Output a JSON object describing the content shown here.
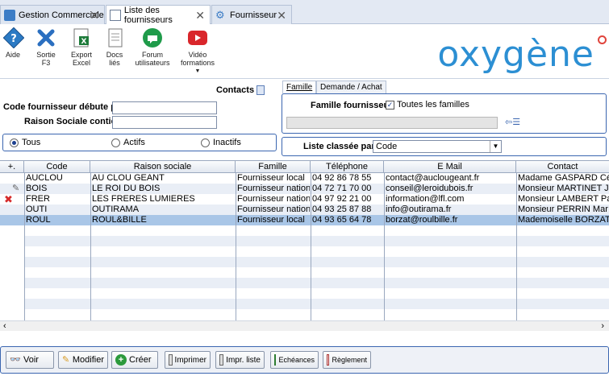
{
  "tabs": [
    {
      "label": "Gestion Commerciale"
    },
    {
      "label": "Liste des fournisseurs"
    },
    {
      "label": "Fournisseur"
    }
  ],
  "toolbar": {
    "aide": "Aide",
    "sortie": "Sortie",
    "sortie2": "F3",
    "export": "Export",
    "export2": "Excel",
    "docs": "Docs",
    "docs2": "liés",
    "forum": "Forum",
    "forum2": "utilisateurs",
    "video": "Vidéo",
    "video2": "formations",
    "logo": "oxygène"
  },
  "filters": {
    "contacts": "Contacts",
    "code_label": "Code fournisseur débute par",
    "code_value": "",
    "raison_label": "Raison Sociale contient",
    "raison_value": "",
    "radio_tous": "Tous",
    "radio_actifs": "Actifs",
    "radio_inactifs": "Inactifs"
  },
  "family": {
    "tab1": "Famille",
    "tab2": "Demande / Achat",
    "label": "Famille fournisseur",
    "toutes": "Toutes les familles",
    "sort_label": "Liste classée par",
    "sort_value": "Code"
  },
  "grid": {
    "headers": [
      "Code",
      "Raison sociale",
      "Famille",
      "Téléphone",
      "E Mail",
      "Contact"
    ],
    "rows": [
      {
        "code": "AUCLOU",
        "raison": "AU CLOU GEANT",
        "famille": "Fournisseur local",
        "tel": "04 92 86 78 55",
        "email": "contact@auclougeant.fr",
        "contact": "Madame GASPARD Cé"
      },
      {
        "code": "BOIS",
        "raison": "LE ROI DU BOIS",
        "famille": "Fournisseur nationa",
        "tel": "04 72 71 70 00",
        "email": "conseil@leroidubois.fr",
        "contact": "Monsieur MARTINET J"
      },
      {
        "code": "FRER",
        "raison": "LES FRERES LUMIERES",
        "famille": "Fournisseur nationa",
        "tel": "04 97 92 21 00",
        "email": "information@lfl.com",
        "contact": "Monsieur LAMBERT Pa"
      },
      {
        "code": "OUTI",
        "raison": "OUTIRAMA",
        "famille": "Fournisseur nationa",
        "tel": "04 93 25 87 88",
        "email": "info@outirama.fr",
        "contact": "Monsieur PERRIN Mar"
      },
      {
        "code": "ROUL",
        "raison": "ROUL&BILLE",
        "famille": "Fournisseur local",
        "tel": "04 93 65 64 78",
        "email": "borzat@roulbille.fr",
        "contact": "Mademoiselle BORZAT"
      }
    ]
  },
  "bottom": {
    "voir": "Voir",
    "modifier": "Modifier",
    "creer": "Créer",
    "imprimer": "Imprimer",
    "impr_liste": "Impr. liste",
    "echeances": "Echéances",
    "reglement": "Règlement"
  },
  "colors": {
    "accent": "#3b66b0",
    "selection": "#a9c6e7",
    "logo": "#2c8fd3"
  }
}
